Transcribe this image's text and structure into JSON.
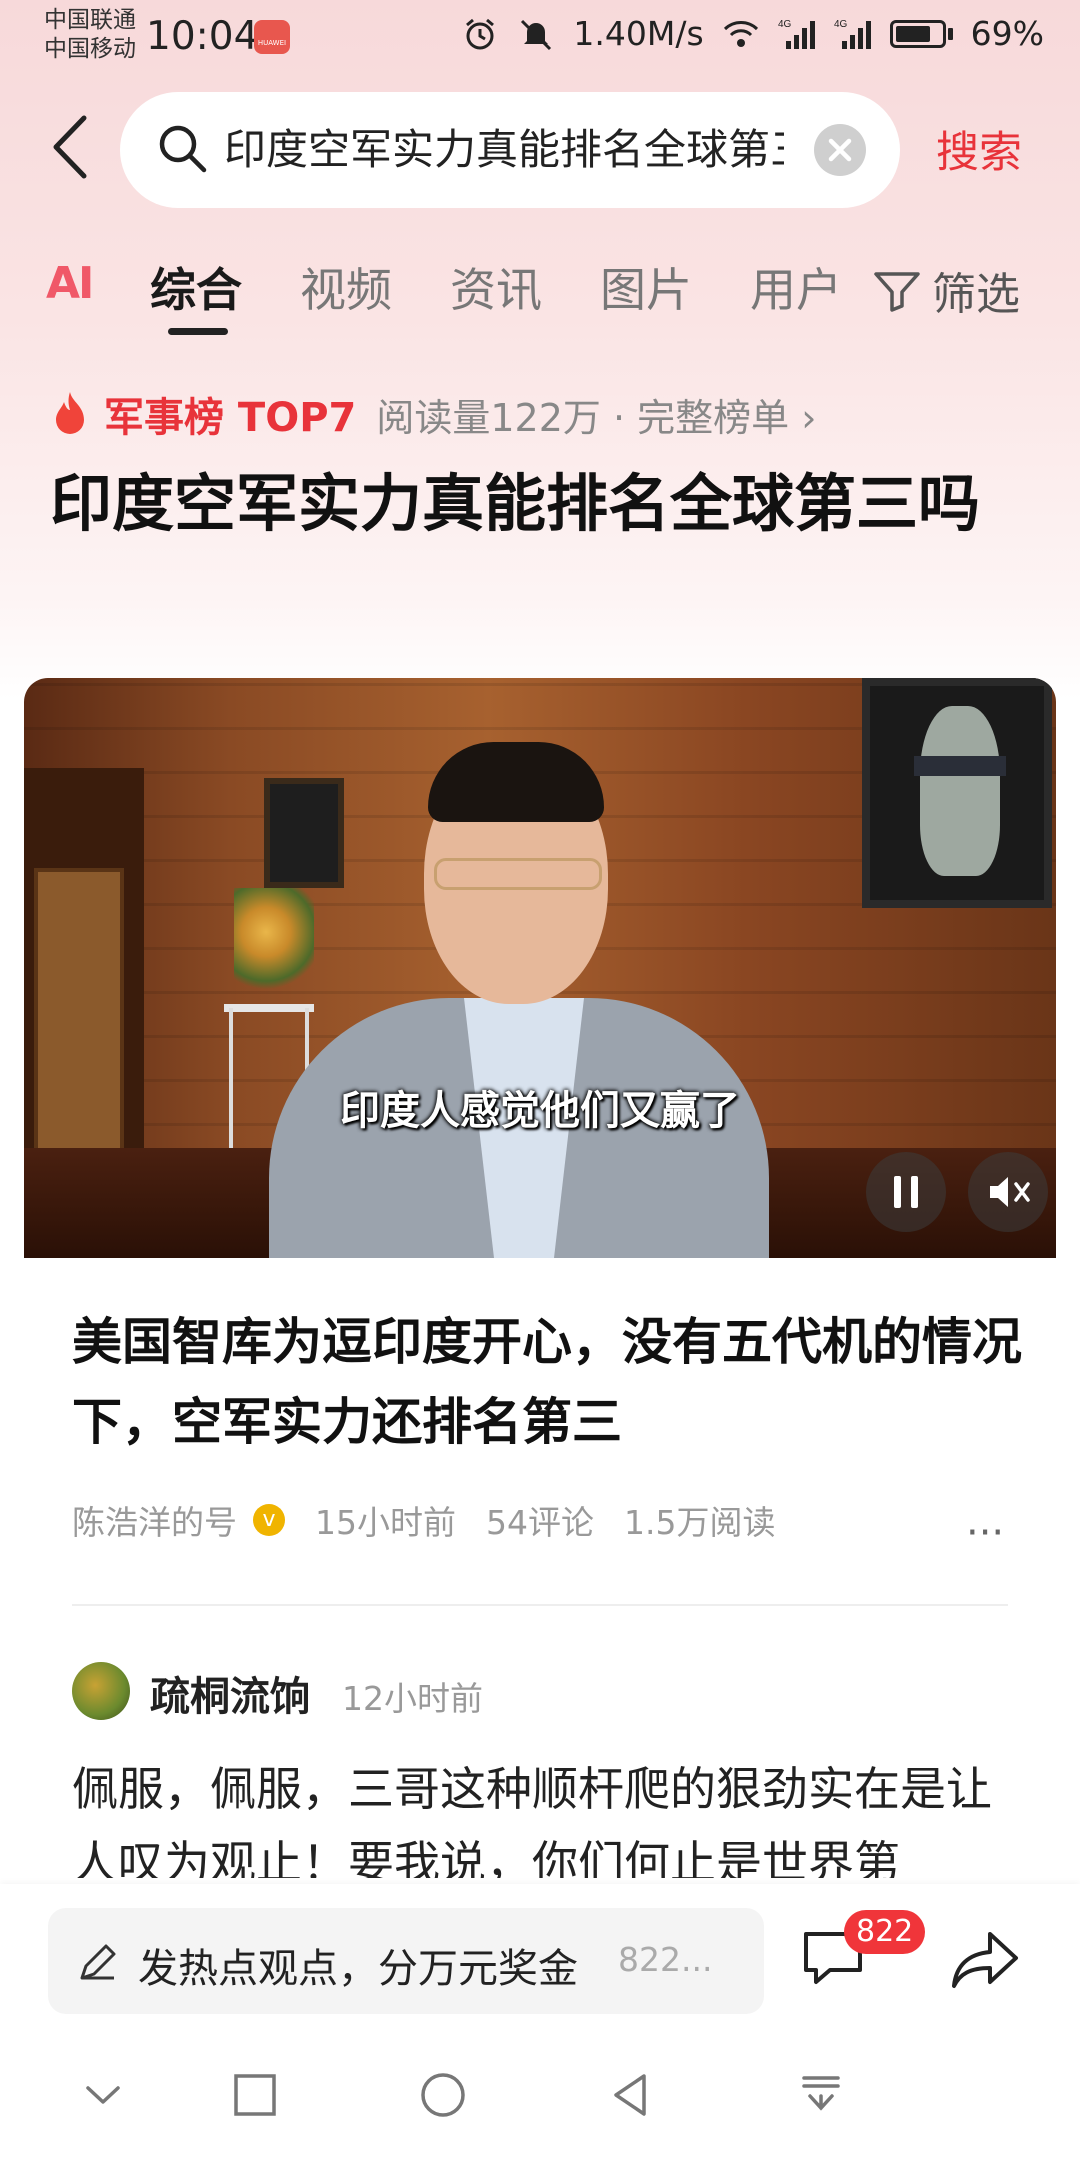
{
  "status_bar": {
    "carrier_1": "中国联通",
    "carrier_2": "中国移动",
    "time": "10:04",
    "app_badge": "HUAWEI",
    "net_speed": "1.40M/s",
    "signal_1": "4G",
    "signal_2": "4G",
    "battery": "69%"
  },
  "search": {
    "value": "印度空军实力真能排名全球第三吗",
    "button_label": "搜索"
  },
  "tabs": {
    "ai_label": "AI",
    "items": [
      {
        "label": "综合",
        "active": true
      },
      {
        "label": "视频"
      },
      {
        "label": "资讯"
      },
      {
        "label": "图片"
      },
      {
        "label": "用户"
      }
    ],
    "filter_label": "筛选"
  },
  "ranking": {
    "label": "军事榜 TOP7",
    "meta": "阅读量122万 · 完整榜单 ›"
  },
  "headline": "印度空军实力真能排名全球第三吗",
  "video": {
    "subtitle": "印度人感觉他们又赢了"
  },
  "article": {
    "title": "美国智库为逗印度开心，没有五代机的情况下，空军实力还排名第三",
    "author": "陈浩洋的号",
    "time": "15小时前",
    "comments": "54评论",
    "reads": "1.5万阅读",
    "more": "···"
  },
  "comment": {
    "user": "疏桐流饷",
    "time": "12小时前",
    "text": "佩服，佩服，三哥这种顺杆爬的狠劲实在是让人叹为观止！要我说，你们何止是世界第"
  },
  "bottom_bar": {
    "input_placeholder": "发热点观点，分万元奖金",
    "input_count": "822...",
    "badge_count": "822"
  },
  "colors": {
    "accent_red": "#e8333a",
    "header_bg": "#f7d9da"
  }
}
